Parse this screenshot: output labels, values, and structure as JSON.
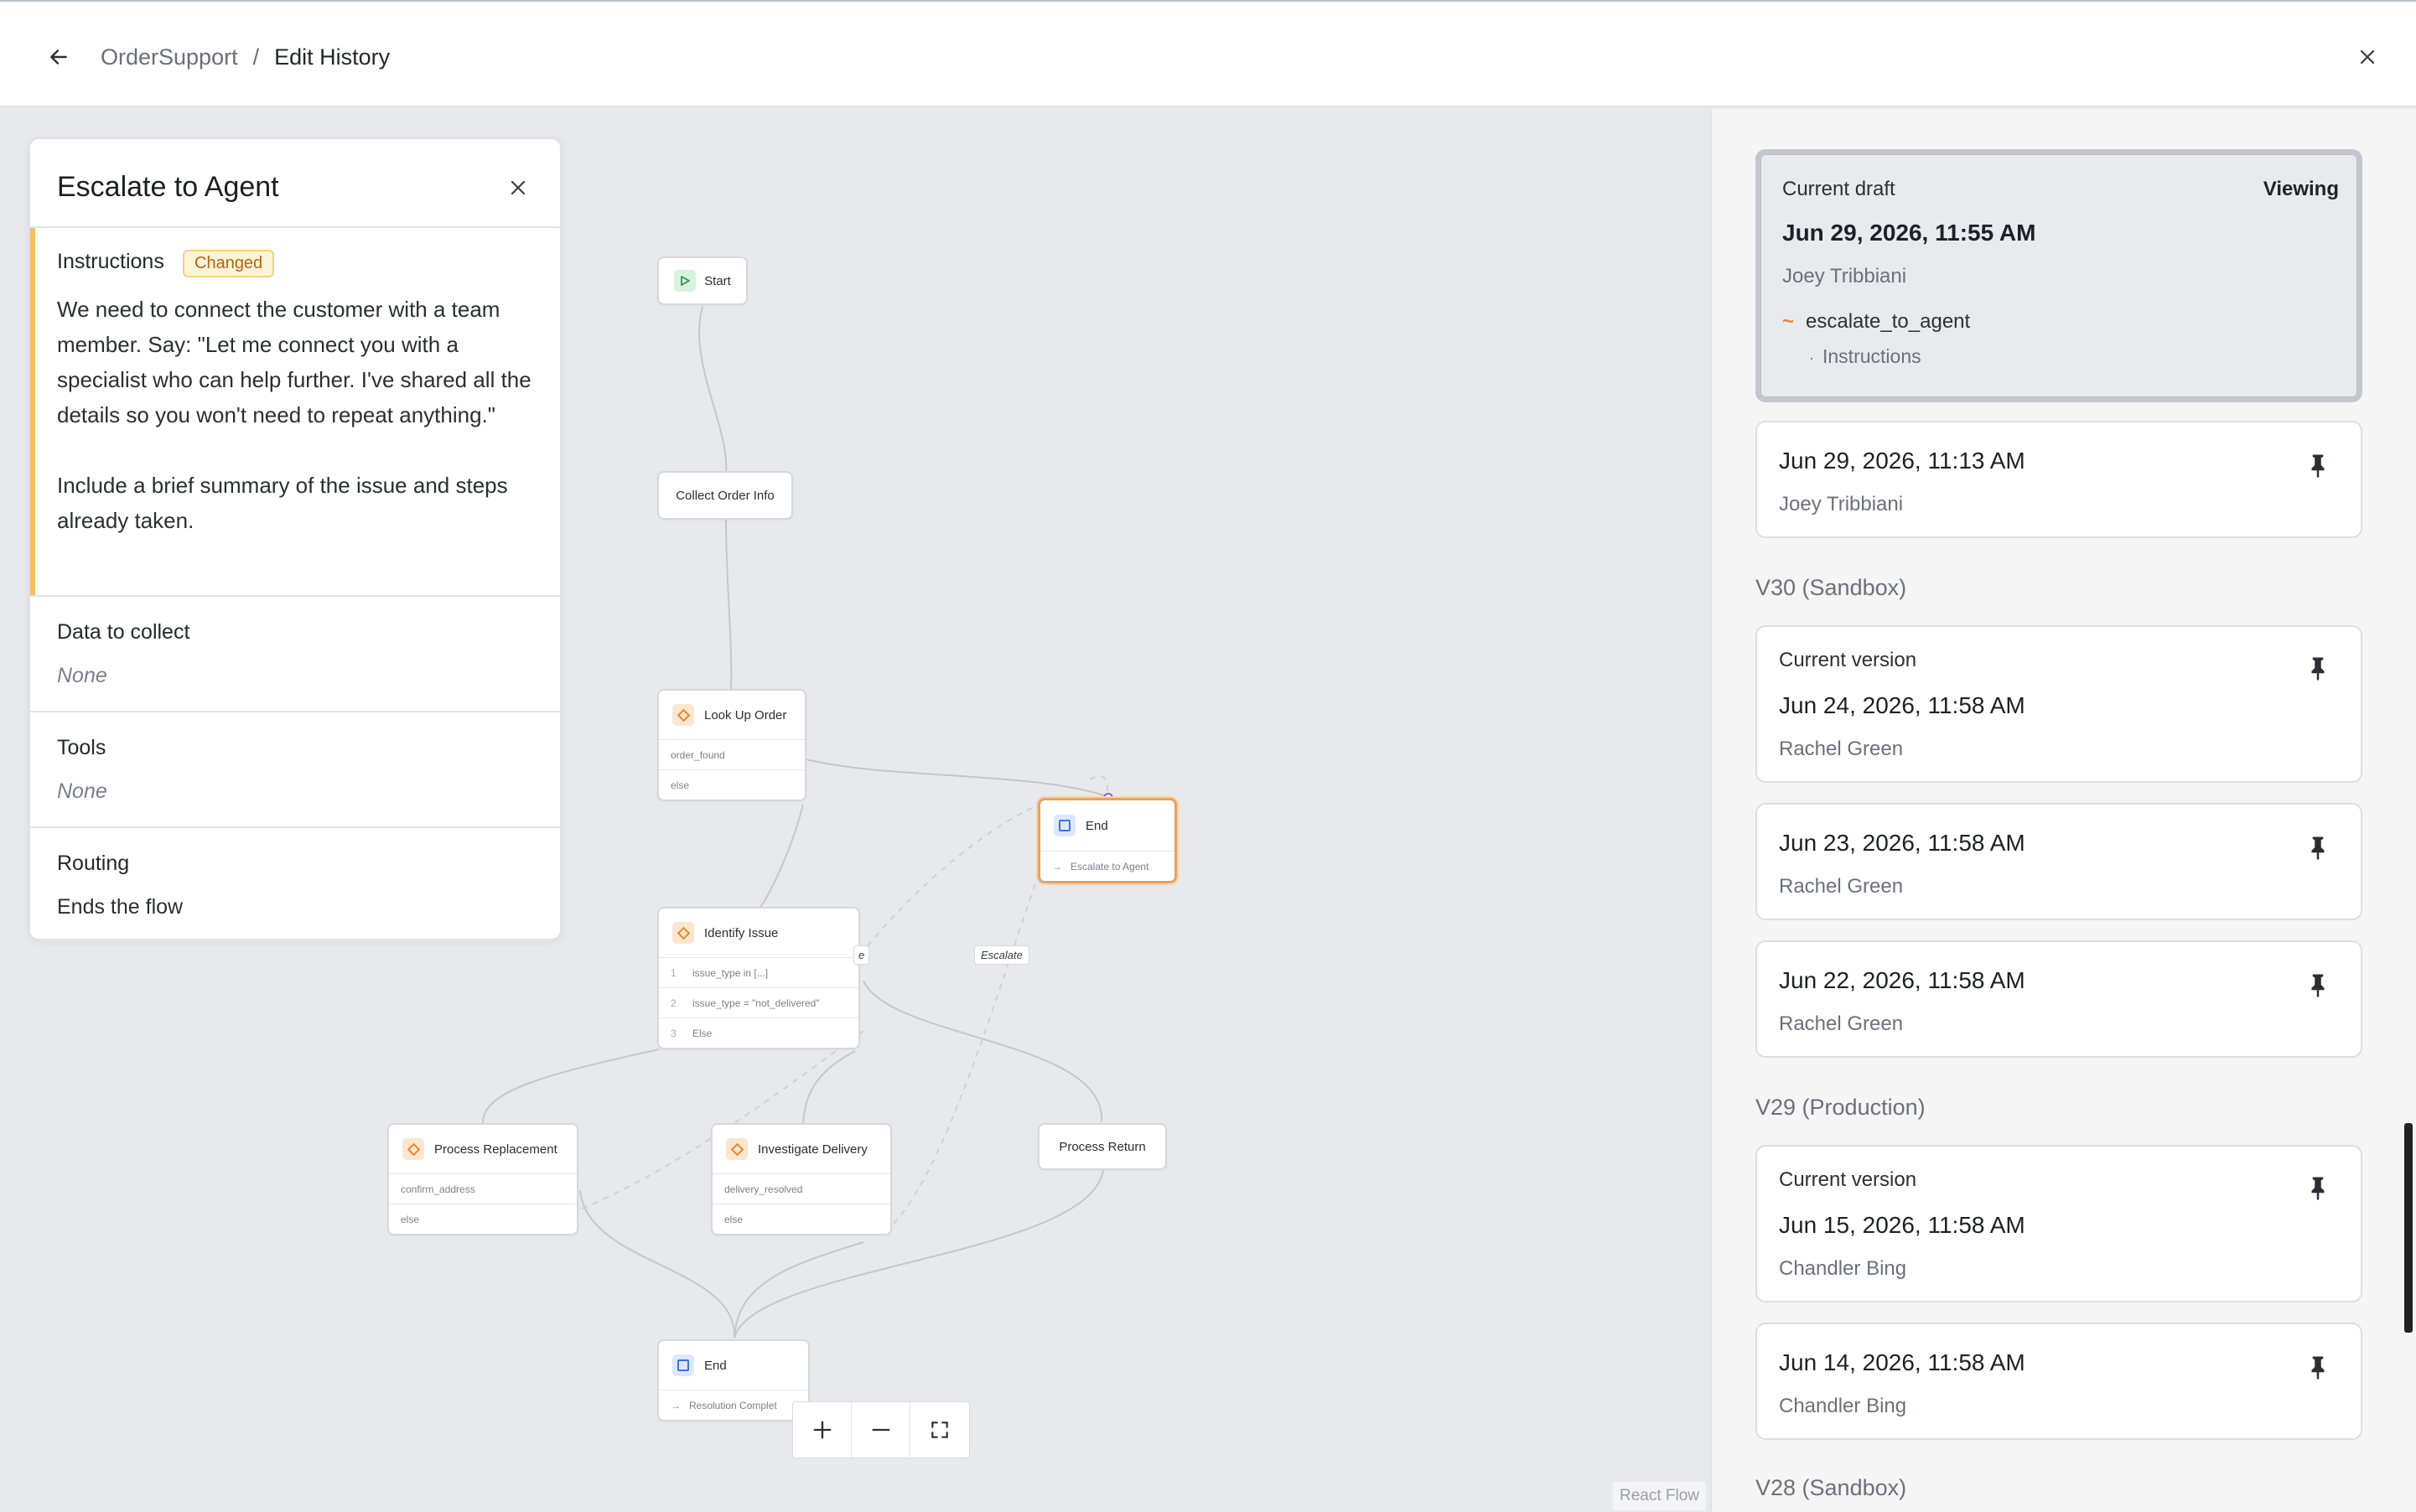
{
  "header": {
    "breadcrumb_root": "OrderSupport",
    "breadcrumb_sep": "/",
    "breadcrumb_current": "Edit History"
  },
  "panel": {
    "title": "Escalate to Agent",
    "instructions_label": "Instructions",
    "changed_badge": "Changed",
    "instructions_text": "We need to connect the customer with a team member. Say: \"Let me connect you with a specialist who can help further. I've shared all the details so you won't need to repeat anything.\"\n\nInclude a brief summary of the issue and steps already taken.",
    "data_label": "Data to collect",
    "data_value": "None",
    "tools_label": "Tools",
    "tools_value": "None",
    "routing_label": "Routing",
    "routing_value": "Ends the flow"
  },
  "flow": {
    "start": "Start",
    "collect": "Collect Order Info",
    "lookup": {
      "title": "Look Up Order",
      "rows": [
        "order_found",
        "else"
      ]
    },
    "end_escalate": {
      "title": "End",
      "sub": "Escalate to Agent"
    },
    "identify": {
      "title": "Identify Issue",
      "rows": [
        {
          "n": "1",
          "t": "issue_type in [...]"
        },
        {
          "n": "2",
          "t": "issue_type = \"not_delivered\""
        },
        {
          "n": "3",
          "t": "Else"
        }
      ]
    },
    "edge_label_partial": "e",
    "edge_label_escalate": "Escalate",
    "replacement": {
      "title": "Process Replacement",
      "rows": [
        "confirm_address",
        "else"
      ]
    },
    "investigate": {
      "title": "Investigate Delivery",
      "rows": [
        "delivery_resolved",
        "else"
      ]
    },
    "return": "Process Return",
    "end_resolution": {
      "title": "End",
      "sub": "Resolution Complet"
    },
    "attribution": "React Flow"
  },
  "history": {
    "draft": {
      "label": "Current draft",
      "viewing": "Viewing",
      "date": "Jun 29, 2026, 11:55 AM",
      "author": "Joey Tribbiani",
      "change_symbol": "~",
      "change_node": "escalate_to_agent",
      "change_field_bullet": "·",
      "change_field": "Instructions"
    },
    "draft_prev": {
      "date": "Jun 29, 2026, 11:13 AM",
      "author": "Joey Tribbiani"
    },
    "v30": {
      "heading": "V30 (Sandbox)",
      "items": [
        {
          "label": "Current version",
          "date": "Jun 24, 2026, 11:58 AM",
          "author": "Rachel Green"
        },
        {
          "date": "Jun 23, 2026, 11:58 AM",
          "author": "Rachel Green"
        },
        {
          "date": "Jun 22, 2026, 11:58 AM",
          "author": "Rachel Green"
        }
      ]
    },
    "v29": {
      "heading": "V29 (Production)",
      "items": [
        {
          "label": "Current version",
          "date": "Jun 15, 2026, 11:58 AM",
          "author": "Chandler Bing"
        },
        {
          "date": "Jun 14, 2026, 11:58 AM",
          "author": "Chandler Bing"
        }
      ]
    },
    "v28": {
      "heading": "V28 (Sandbox)"
    }
  },
  "colors": {
    "accent_changed": "#e08a2e",
    "selected_border": "#e8a25e",
    "badge_bg": "#fdf3d6"
  }
}
